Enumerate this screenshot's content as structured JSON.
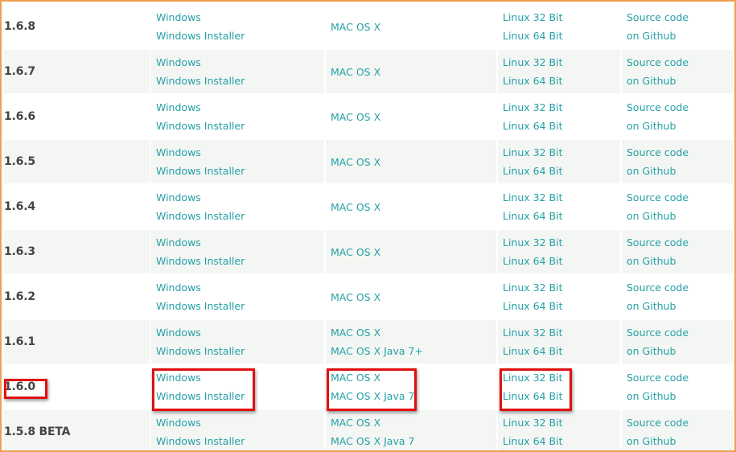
{
  "rows": [
    {
      "version": "1.6.8",
      "windows": "Windows",
      "windows_installer": "Windows Installer",
      "mac": "MAC OS X",
      "mac2": "",
      "linux32": "Linux 32 Bit",
      "linux64": "Linux 64 Bit",
      "source1": "Source code",
      "source2": "on Github"
    },
    {
      "version": "1.6.7",
      "windows": "Windows",
      "windows_installer": "Windows Installer",
      "mac": "MAC OS X",
      "mac2": "",
      "linux32": "Linux 32 Bit",
      "linux64": "Linux 64 Bit",
      "source1": "Source code",
      "source2": "on Github"
    },
    {
      "version": "1.6.6",
      "windows": "Windows",
      "windows_installer": "Windows Installer",
      "mac": "MAC OS X",
      "mac2": "",
      "linux32": "Linux 32 Bit",
      "linux64": "Linux 64 Bit",
      "source1": "Source code",
      "source2": "on Github"
    },
    {
      "version": "1.6.5",
      "windows": "Windows",
      "windows_installer": "Windows Installer",
      "mac": "MAC OS X",
      "mac2": "",
      "linux32": "Linux 32 Bit",
      "linux64": "Linux 64 Bit",
      "source1": "Source code",
      "source2": "on Github"
    },
    {
      "version": "1.6.4",
      "windows": "Windows",
      "windows_installer": "Windows Installer",
      "mac": "MAC OS X",
      "mac2": "",
      "linux32": "Linux 32 Bit",
      "linux64": "Linux 64 Bit",
      "source1": "Source code",
      "source2": "on Github"
    },
    {
      "version": "1.6.3",
      "windows": "Windows",
      "windows_installer": "Windows Installer",
      "mac": "MAC OS X",
      "mac2": "",
      "linux32": "Linux 32 Bit",
      "linux64": "Linux 64 Bit",
      "source1": "Source code",
      "source2": "on Github"
    },
    {
      "version": "1.6.2",
      "windows": "Windows",
      "windows_installer": "Windows Installer",
      "mac": "MAC OS X",
      "mac2": "",
      "linux32": "Linux 32 Bit",
      "linux64": "Linux 64 Bit",
      "source1": "Source code",
      "source2": "on Github"
    },
    {
      "version": "1.6.1",
      "windows": "Windows",
      "windows_installer": "Windows Installer",
      "mac": "MAC OS X",
      "mac2": "MAC OS X Java 7+",
      "linux32": "Linux 32 Bit",
      "linux64": "Linux 64 Bit",
      "source1": "Source code",
      "source2": "on Github"
    },
    {
      "version": "1.6.0",
      "windows": "Windows",
      "windows_installer": "Windows Installer",
      "mac": "MAC OS X",
      "mac2": "MAC OS X Java 7",
      "linux32": "Linux 32 Bit",
      "linux64": "Linux 64 Bit",
      "source1": "Source code",
      "source2": "on Github"
    },
    {
      "version": "1.5.8 BETA",
      "windows": "Windows",
      "windows_installer": "Windows Installer",
      "mac": "MAC OS X",
      "mac2": "MAC OS X Java 7",
      "linux32": "Linux 32 Bit",
      "linux64": "Linux 64 Bit",
      "source1": "Source code",
      "source2": "on Github"
    }
  ],
  "colors": {
    "link": "#25a0a6",
    "version_text": "#444444",
    "highlight": "#e01010",
    "frame_border": "#f0a050",
    "row_alt_bg": "#f4f6f4"
  }
}
